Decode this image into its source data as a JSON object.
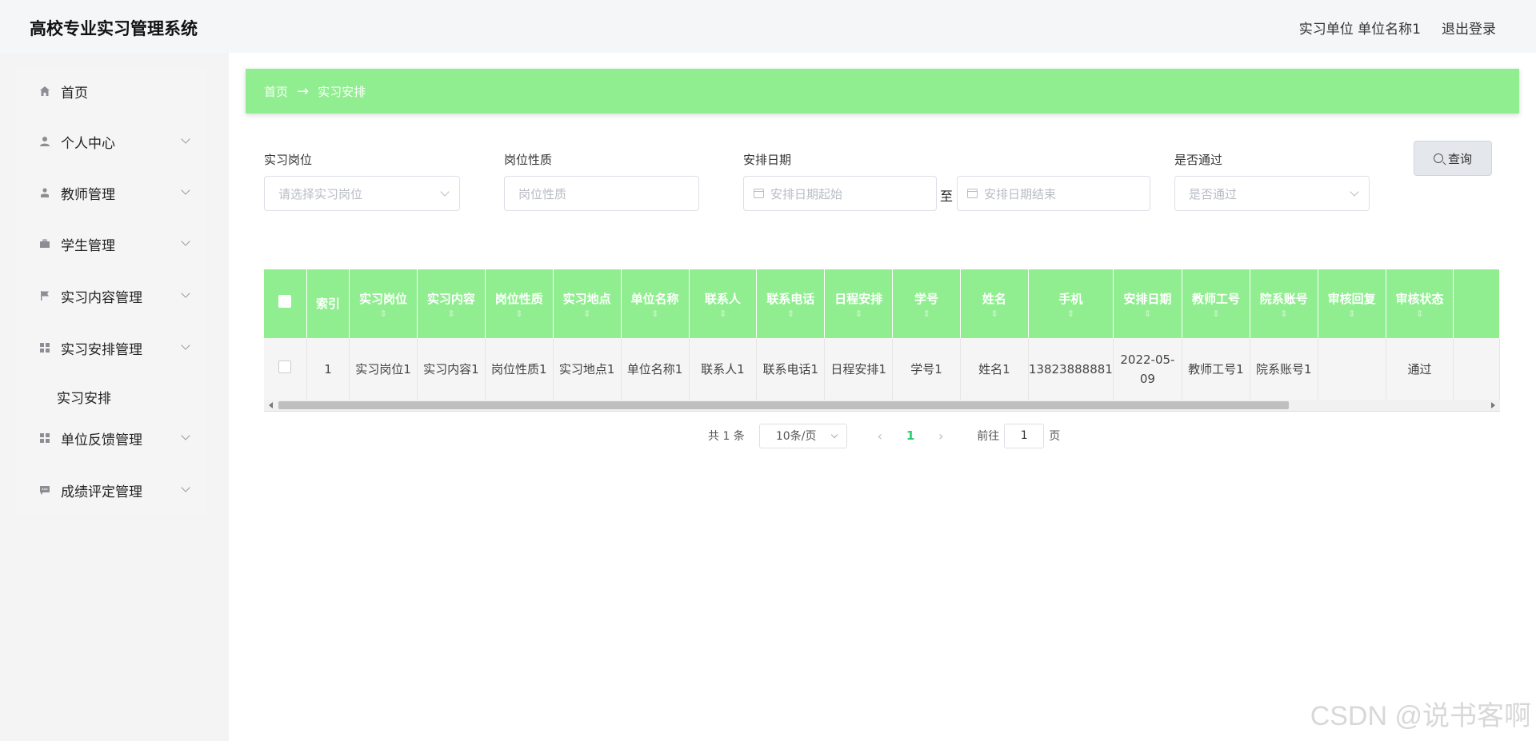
{
  "app": {
    "title": "高校专业实习管理系统"
  },
  "header": {
    "user_info": "实习单位 单位名称1",
    "logout": "退出登录"
  },
  "sidebar": {
    "items": [
      {
        "label": "首页",
        "icon": "home-icon",
        "has_children": false
      },
      {
        "label": "个人中心",
        "icon": "user-icon",
        "has_children": true
      },
      {
        "label": "教师管理",
        "icon": "teacher-icon",
        "has_children": true
      },
      {
        "label": "学生管理",
        "icon": "briefcase-icon",
        "has_children": true
      },
      {
        "label": "实习内容管理",
        "icon": "flag-icon",
        "has_children": true
      },
      {
        "label": "实习安排管理",
        "icon": "grid-icon",
        "has_children": true,
        "expanded": true,
        "children": [
          "实习安排"
        ]
      },
      {
        "label": "单位反馈管理",
        "icon": "grid-icon",
        "has_children": true
      },
      {
        "label": "成绩评定管理",
        "icon": "chat-icon",
        "has_children": true
      }
    ]
  },
  "breadcrumb": {
    "home": "首页",
    "arrow": "→",
    "current": "实习安排"
  },
  "filters": {
    "post_label": "实习岗位",
    "post_placeholder": "请选择实习岗位",
    "nature_label": "岗位性质",
    "nature_placeholder": "岗位性质",
    "date_label": "安排日期",
    "date_start_placeholder": "安排日期起始",
    "date_to": "至",
    "date_end_placeholder": "安排日期结束",
    "passed_label": "是否通过",
    "passed_placeholder": "是否通过",
    "search_button": "查询"
  },
  "table": {
    "columns": [
      "索引",
      "实习岗位",
      "实习内容",
      "岗位性质",
      "实习地点",
      "单位名称",
      "联系人",
      "联系电话",
      "日程安排",
      "学号",
      "姓名",
      "手机",
      "安排日期",
      "教师工号",
      "院系账号",
      "审核回复",
      "审核状态"
    ],
    "rows": [
      [
        "1",
        "实习岗位1",
        "实习内容1",
        "岗位性质1",
        "实习地点1",
        "单位名称1",
        "联系人1",
        "联系电话1",
        "日程安排1",
        "学号1",
        "姓名1",
        "13823888881",
        "2022-05-09",
        "教师工号1",
        "院系账号1",
        "",
        "通过"
      ]
    ]
  },
  "pagination": {
    "total": "共 1 条",
    "page_size": "10条/页",
    "current_page": "1",
    "goto_prefix": "前往",
    "goto_value": "1",
    "goto_suffix": "页"
  },
  "watermark": "CSDN @说书客啊",
  "colors": {
    "accent": "#90ee90",
    "page_active": "#2ecc71"
  }
}
